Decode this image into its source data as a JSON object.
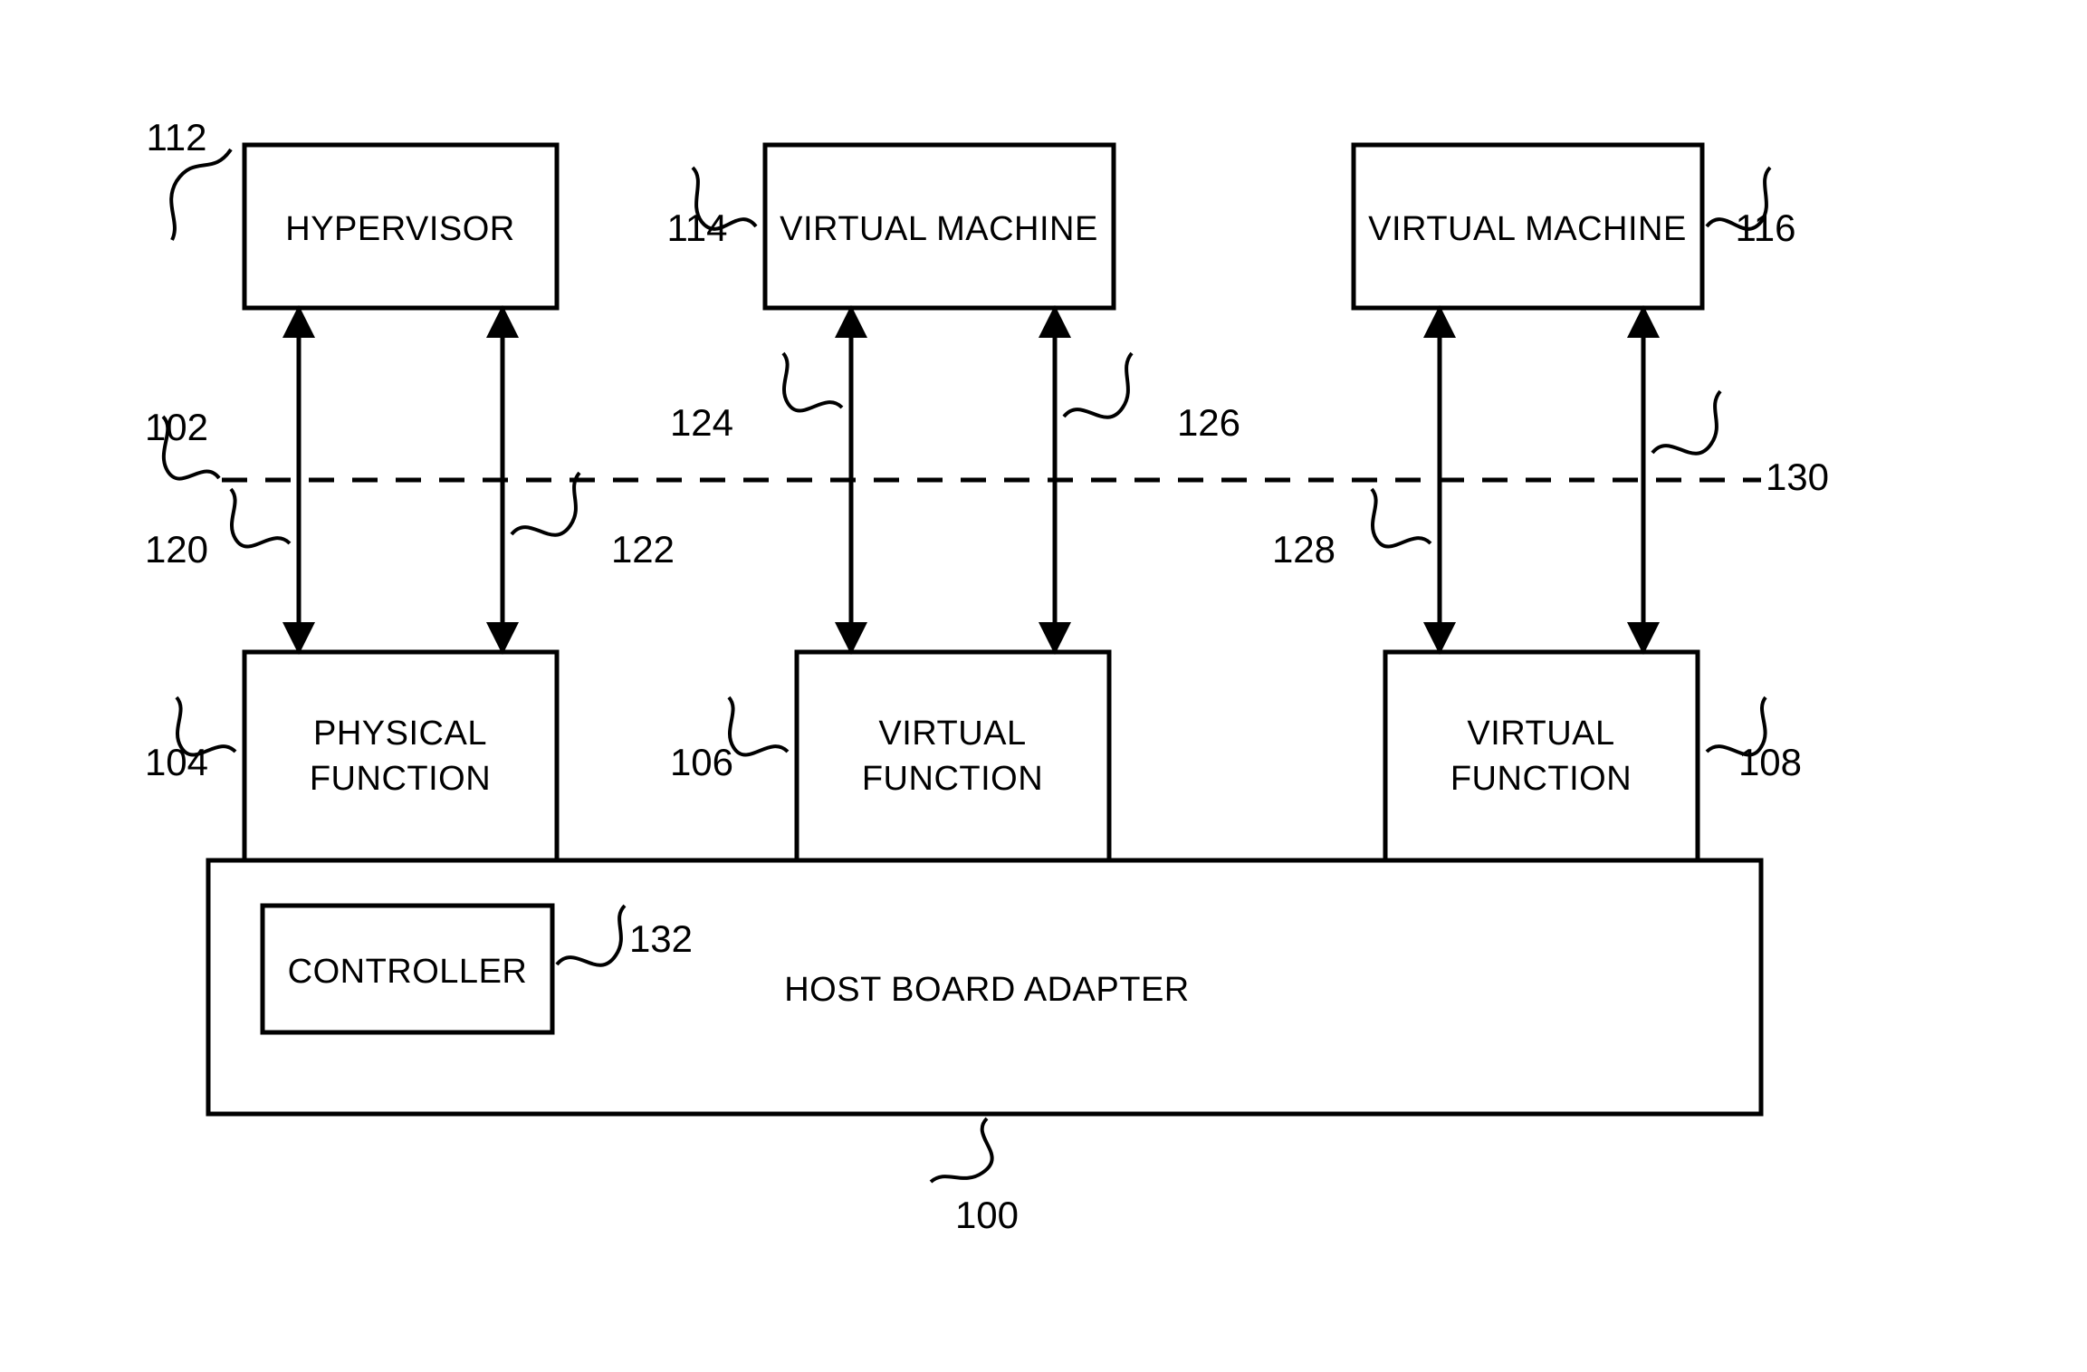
{
  "nodes": {
    "hypervisor": {
      "label": "HYPERVISOR",
      "ref": "112"
    },
    "vm1": {
      "label": "VIRTUAL MACHINE",
      "ref": "114"
    },
    "vm2": {
      "label": "VIRTUAL MACHINE",
      "ref": "116"
    },
    "pfunc": {
      "label_l1": "PHYSICAL",
      "label_l2": "FUNCTION",
      "ref": "104"
    },
    "vfunc1": {
      "label_l1": "VIRTUAL",
      "label_l2": "FUNCTION",
      "ref": "106"
    },
    "vfunc2": {
      "label_l1": "VIRTUAL",
      "label_l2": "FUNCTION",
      "ref": "108"
    },
    "controller": {
      "label": "CONTROLLER",
      "ref": "132"
    },
    "hba": {
      "label": "HOST BOARD ADAPTER",
      "ref": "100"
    }
  },
  "boundary_ref": "102",
  "arrows": {
    "a120": "120",
    "a122": "122",
    "a124": "124",
    "a126": "126",
    "a128": "128",
    "a130": "130"
  }
}
